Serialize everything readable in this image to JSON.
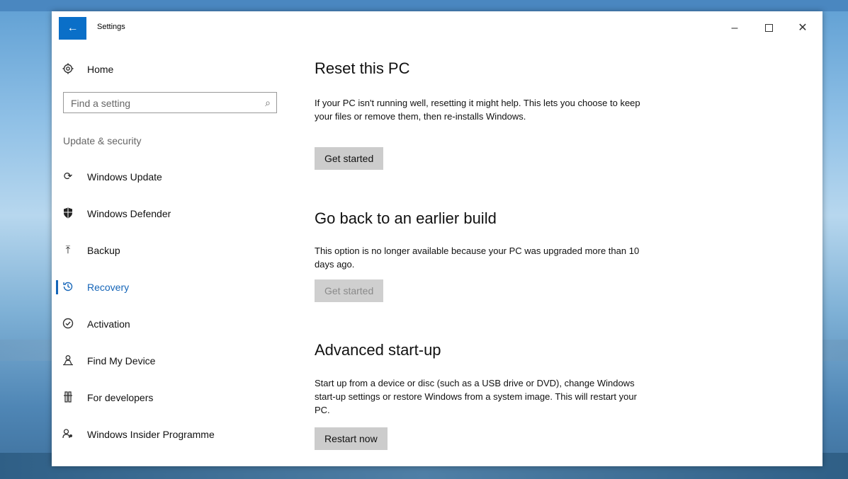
{
  "window": {
    "title": "Settings",
    "back_icon": "←",
    "minimize_icon": "–",
    "close_icon": "✕"
  },
  "sidebar": {
    "home": {
      "label": "Home",
      "icon": "gear-icon"
    },
    "search": {
      "placeholder": "Find a setting",
      "value": ""
    },
    "section_title": "Update & security",
    "items": [
      {
        "label": "Windows Update",
        "icon": "sync-icon",
        "active": false
      },
      {
        "label": "Windows Defender",
        "icon": "shield-icon",
        "active": false
      },
      {
        "label": "Backup",
        "icon": "upload-icon",
        "active": false
      },
      {
        "label": "Recovery",
        "icon": "history-icon",
        "active": true
      },
      {
        "label": "Activation",
        "icon": "check-circle-icon",
        "active": false
      },
      {
        "label": "Find My Device",
        "icon": "person-pin-icon",
        "active": false
      },
      {
        "label": "For developers",
        "icon": "tools-icon",
        "active": false
      },
      {
        "label": "Windows Insider Programme",
        "icon": "insider-icon",
        "active": false
      }
    ],
    "accent_color": "#1565b8"
  },
  "content": {
    "sections": [
      {
        "title": "Reset this PC",
        "description": "If your PC isn't running well, resetting it might help. This lets you choose to keep your files or remove them, then re-installs Windows.",
        "button": "Get started",
        "button_enabled": true
      },
      {
        "title": "Go back to an earlier build",
        "description": "This option is no longer available because your PC was upgraded more than 10 days ago.",
        "button": "Get started",
        "button_enabled": false
      },
      {
        "title": "Advanced start-up",
        "description": "Start up from a device or disc (such as a USB drive or DVD), change Windows start-up settings or restore Windows from a system image. This will restart your PC.",
        "button": "Restart now",
        "button_enabled": true
      }
    ]
  }
}
